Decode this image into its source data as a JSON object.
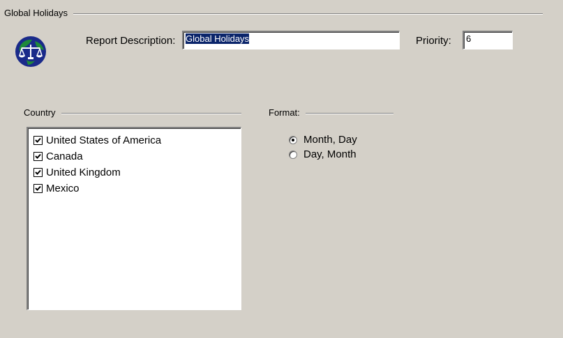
{
  "report_group": {
    "label": "Global Holidays"
  },
  "description": {
    "label": "Report Description:",
    "value": "Global Holidays"
  },
  "priority": {
    "label": "Priority:",
    "value": "6"
  },
  "country": {
    "label": "Country",
    "items": [
      {
        "label": "United States of America",
        "checked": true
      },
      {
        "label": "Canada",
        "checked": true
      },
      {
        "label": "United Kingdom",
        "checked": true
      },
      {
        "label": "Mexico",
        "checked": true
      }
    ]
  },
  "format": {
    "label": "Format:",
    "options": [
      {
        "label": "Month, Day",
        "selected": true
      },
      {
        "label": "Day, Month",
        "selected": false
      }
    ]
  },
  "colors": {
    "background": "#d4d0c8",
    "selection": "#0a246a",
    "globe_blue": "#1a2a8a",
    "globe_green": "#1f8a3a"
  },
  "icons": {
    "report_icon": "globe-scales-icon"
  }
}
